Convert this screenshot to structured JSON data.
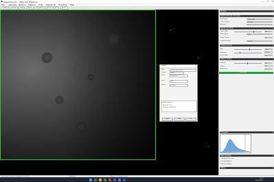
{
  "window": {
    "title": "SharpCap 4.0 — ZWO ASI (Capture)",
    "controls": [
      "—",
      "☐",
      "✕"
    ]
  },
  "menu": [
    "File",
    "Cameras",
    "Options",
    "Capture",
    "Tools",
    "Sequencer",
    "Scripting",
    "Help"
  ],
  "toolbar": {
    "buttons": [
      "Capture",
      "Start",
      "Stop",
      "Pause",
      "Snapshot",
      "Quick Capture",
      "Zoom"
    ]
  },
  "dialog": {
    "title": "Capture",
    "rows": [
      {
        "label": "Type",
        "value": "Planet/Lunar (Mono)"
      },
      {
        "label": "Object",
        "value": "Moon"
      },
      {
        "label": "Limit",
        "value": "Unlimited"
      },
      {
        "label": "Save",
        "value": "SER"
      },
      {
        "label": "Mode",
        "value": "Frames"
      }
    ],
    "summary": [
      "Mode: Frames",
      "Frames: 0 / 0",
      "Elapsed: 00:00:00"
    ],
    "buttons": [
      "Start",
      "Stop",
      "OK"
    ]
  },
  "panel": {
    "sections": [
      "Camera",
      "Capture Format and Area",
      "Camera Controls",
      "Image Controls",
      "Display Stretch",
      "Histogram",
      "Preprocessing",
      "Testing"
    ],
    "camera_rows": [
      {
        "label": "Resolution",
        "value": "1920x1080"
      },
      {
        "label": "Colour Space",
        "value": "MONO8"
      },
      {
        "label": "Binning",
        "value": "1"
      },
      {
        "label": "Turbo USB",
        "value": "80"
      },
      {
        "label": "USB Speed",
        "value": "High"
      },
      {
        "label": "Target Temp",
        "value": "0"
      },
      {
        "label": "Output Format",
        "value": "SER file"
      }
    ],
    "control_rows": [
      {
        "label": "Gain",
        "value": "250"
      },
      {
        "label": "Exposure",
        "value": "8.5 ms"
      },
      {
        "label": "Frame Rate",
        "value": "50"
      },
      {
        "label": "Gamma",
        "value": "50"
      },
      {
        "label": "Offset",
        "value": "10"
      },
      {
        "label": "Brightness",
        "value": "0"
      }
    ],
    "active_label": "Live Stack",
    "checkboxes": [
      "Debayer Preview",
      "Colour Adjust",
      "Reduce Noise"
    ]
  },
  "status": {
    "left": "Previewing : 0 frames (0 dropped) in 0:00:00",
    "mid": "Capturing",
    "right": "Memory: 1 of 4 frames in use"
  },
  "taskbar": {
    "time": "10:25",
    "date": "20/03/2024"
  }
}
